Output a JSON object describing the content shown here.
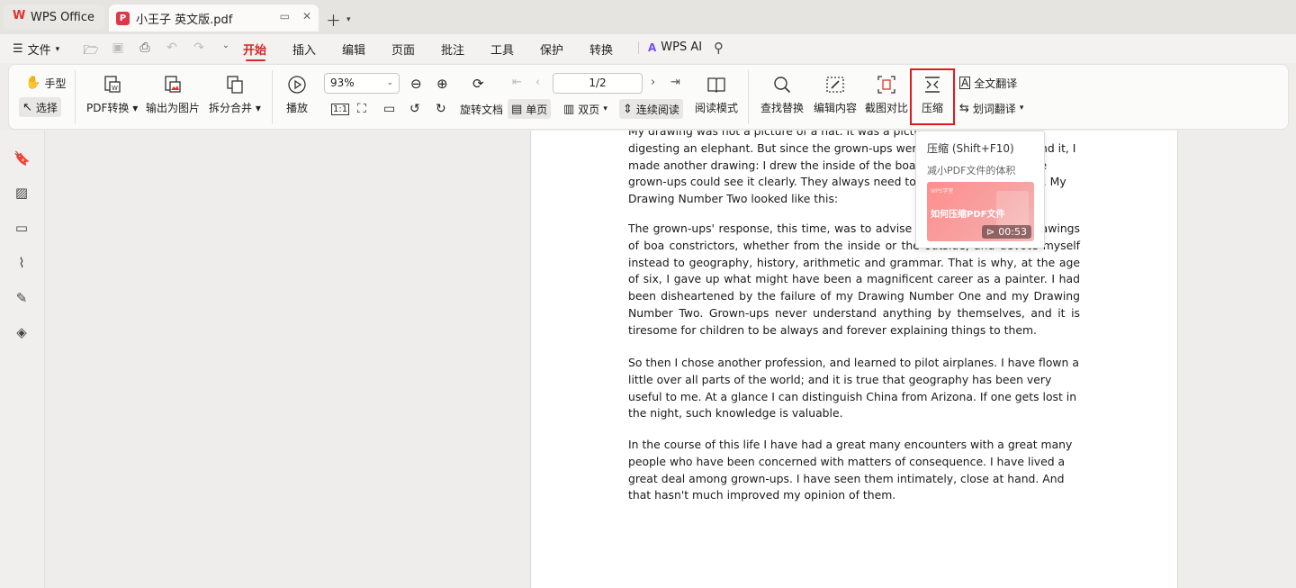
{
  "tabs": {
    "home_label": "WPS Office",
    "doc_title": "小王子 英文版.pdf"
  },
  "menu": {
    "file_label": "文件",
    "tabs": [
      "开始",
      "插入",
      "编辑",
      "页面",
      "批注",
      "工具",
      "保护",
      "转换"
    ],
    "active_tab": "开始",
    "ai_label": "WPS AI"
  },
  "toolbar": {
    "hand": "手型",
    "select": "选择",
    "pdf_convert": "PDF转换",
    "export_image": "输出为图片",
    "split_merge": "拆分合并",
    "play": "播放",
    "zoom": "93%",
    "rotate": "旋转文档",
    "single_page": "单页",
    "double_page": "双页",
    "continuous": "连续阅读",
    "read_mode": "阅读模式",
    "find_replace": "查找替换",
    "edit_content": "编辑内容",
    "screenshot_compare": "截图对比",
    "compress": "压缩",
    "full_translate": "全文翻译",
    "word_translate": "划词翻译",
    "page_indicator": "1/2",
    "actual_size": "1:1"
  },
  "tooltip": {
    "title": "压缩 (Shift+F10)",
    "desc": "减小PDF文件的体积",
    "video_tag": "WPS学堂",
    "video_title": "如何压缩PDF文件",
    "video_duration": "00:53"
  },
  "document": {
    "paragraphs": [
      "My drawing was not a picture of a hat. It was a picture of a boa constrictor digesting an elephant. But since the grown-ups were not able to understand it, I made another drawing: I drew the inside of the boa constrictor, so that the grown-ups could see it clearly. They always need to have things explained. My Drawing Number Two looked like this:",
      "The grown-ups' response, this time, was to advise me to lay aside my drawings of boa constrictors, whether from the inside or the outside, and devote myself instead to geography, history, arithmetic and grammar. That is why, at the age of six, I gave up what might have been a magnificent career as a painter. I had been disheartened by the failure of my Drawing Number One and my Drawing Number Two. Grown-ups never understand anything by themselves, and it is tiresome for children to be always and forever explaining things to them.",
      "So then I chose another profession, and learned to pilot airplanes. I have flown a little over all parts of the world; and it is true that geography has been very useful to me. At a glance I can distinguish China from Arizona. If one gets lost in the night, such knowledge is valuable.",
      "In the course of this life I have had a great many encounters with a great many people who have been concerned with matters of consequence. I have lived a great deal among grown-ups. I have seen them intimately, close at hand. And that hasn't much improved my opinion of them."
    ]
  },
  "colors": {
    "accent": "#d6262a",
    "highlight_box": "#e01b1b",
    "ai_brand": "#6f4df4"
  }
}
